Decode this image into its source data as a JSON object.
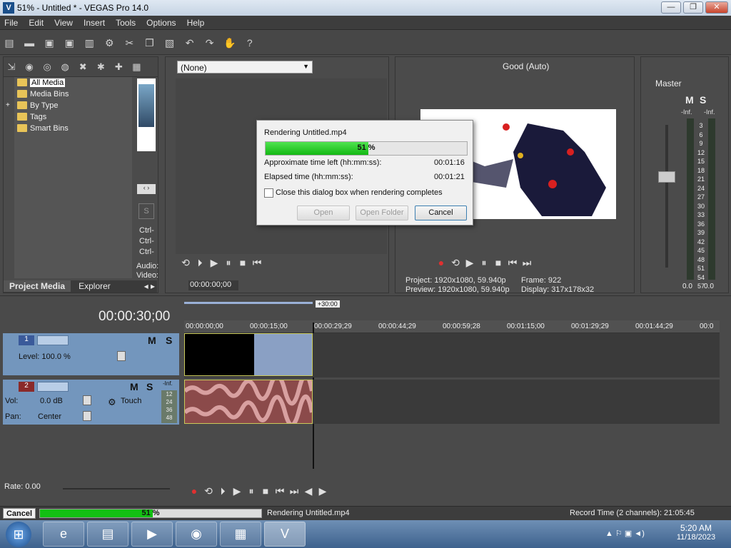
{
  "window": {
    "title": "51% - Untitled * - VEGAS Pro 14.0",
    "app_icon": "vegas-icon",
    "btn_min": "—",
    "btn_max": "❐",
    "btn_close": "✕"
  },
  "menu": [
    "File",
    "Edit",
    "View",
    "Insert",
    "Tools",
    "Options",
    "Help"
  ],
  "project_media": {
    "tree": [
      {
        "label": "All Media",
        "selected": true
      },
      {
        "label": "Media Bins"
      },
      {
        "label": "By Type",
        "expander": "+"
      },
      {
        "label": "Tags"
      },
      {
        "label": "Smart Bins"
      }
    ],
    "tabs": {
      "project_media": "Project Media",
      "explorer": "Explorer"
    },
    "side_labels": [
      "Ctrl-",
      "Ctrl-",
      "Ctrl-"
    ],
    "audio_label": "Audio:",
    "video_label": "Video:"
  },
  "trimmer": {
    "dropdown_value": "(None)",
    "timecode": "00:00:00;00"
  },
  "preview": {
    "quality": "Good (Auto)",
    "project_label": "Project:",
    "project_val": "1920x1080, 59.940p",
    "preview_label": "Preview:",
    "preview_val": "1920x1080, 59.940p",
    "frame_label": "Frame:",
    "frame_val": "922",
    "display_label": "Display:",
    "display_val": "317x178x32"
  },
  "master": {
    "label": "Master",
    "m": "M",
    "s": "S",
    "inf_left": "-Inf.",
    "inf_right": "-Inf.",
    "scale": [
      "3",
      "6",
      "9",
      "12",
      "15",
      "18",
      "21",
      "24",
      "27",
      "30",
      "33",
      "36",
      "39",
      "42",
      "45",
      "48",
      "51",
      "54",
      "57"
    ],
    "val_left": "0.0",
    "val_right": "0.0"
  },
  "render_dialog": {
    "title": "Rendering Untitled.mp4",
    "percent": "51 %",
    "progress": 0.51,
    "time_left_label": "Approximate time left (hh:mm:ss):",
    "time_left": "00:01:16",
    "elapsed_label": "Elapsed time (hh:mm:ss):",
    "elapsed": "00:01:21",
    "close_checkbox_label": "Close this dialog box when rendering completes",
    "open": "Open",
    "open_folder": "Open Folder",
    "cancel": "Cancel"
  },
  "timeline": {
    "time": "00:00:30;00",
    "selection_len": "+30:00",
    "ruler": [
      "00:00:00;00",
      "00:00:15;00",
      "00:00:29;29",
      "00:00:44;29",
      "00:00:59;28",
      "00:01:15;00",
      "00:01:29;29",
      "00:01:44;29",
      "00:0"
    ],
    "track1": {
      "num": "1",
      "level": "Level: 100.0 %",
      "m": "M",
      "s": "S"
    },
    "track2": {
      "num": "2",
      "vol_label": "Vol:",
      "vol": "0.0 dB",
      "pan_label": "Pan:",
      "pan": "Center",
      "mode": "Touch",
      "m": "M",
      "s": "S",
      "inf": "-Inf.",
      "scale": [
        "12",
        "24",
        "36",
        "48"
      ]
    },
    "rate": "Rate: 0.00"
  },
  "status": {
    "cancel": "Cancel",
    "percent": "51 %",
    "progress": 0.51,
    "message": "Rendering Untitled.mp4",
    "record_time": "Record Time (2 channels): 21:05:45"
  },
  "taskbar": {
    "time": "5:20 AM",
    "date": "11/18/2023"
  },
  "colors": {
    "progress": "#13b813",
    "track_header": "#7396bd",
    "audio_clip": "#8b4a4a"
  }
}
